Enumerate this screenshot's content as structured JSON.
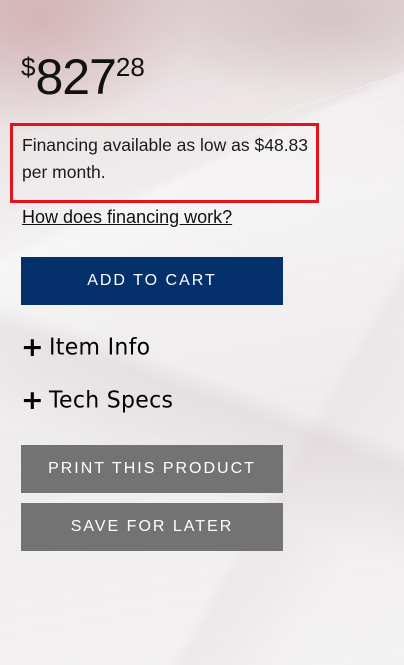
{
  "price": {
    "currency_symbol": "$",
    "dollars": "827",
    "cents": "28"
  },
  "financing": {
    "text": "Financing available as low as $48.83 per month.",
    "link_label": "How does financing work?"
  },
  "actions": {
    "add_to_cart_label": "ADD TO CART",
    "print_label": "PRINT THIS PRODUCT",
    "save_label": "SAVE FOR LATER"
  },
  "sections": {
    "item_info_label": "Item Info",
    "tech_specs_label": "Tech Specs",
    "expand_glyph": "+"
  },
  "colors": {
    "primary_button": "#04316c",
    "secondary_button": "#737373",
    "highlight_border": "#e3121b"
  }
}
